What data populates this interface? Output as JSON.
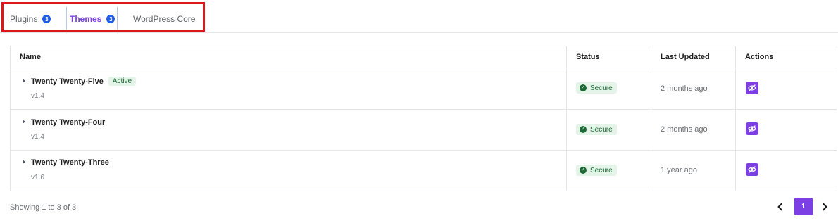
{
  "tabs": {
    "plugins": {
      "label": "Plugins",
      "count": "3"
    },
    "themes": {
      "label": "Themes",
      "count": "3"
    },
    "core": {
      "label": "WordPress Core"
    }
  },
  "table": {
    "headers": {
      "name": "Name",
      "status": "Status",
      "updated": "Last Updated",
      "actions": "Actions"
    },
    "rows": [
      {
        "name": "Twenty Twenty-Five",
        "badge": "Active",
        "version": "v1.4",
        "status": "Secure",
        "updated": "2 months ago",
        "action_icon": "eye-slash-icon"
      },
      {
        "name": "Twenty Twenty-Four",
        "version": "v1.4",
        "status": "Secure",
        "updated": "2 months ago",
        "action_icon": "eye-slash-icon"
      },
      {
        "name": "Twenty Twenty-Three",
        "version": "v1.6",
        "status": "Secure",
        "updated": "1 year ago",
        "action_icon": "eye-slash-icon"
      }
    ]
  },
  "footer": {
    "showing": "Showing 1 to 3 of 3"
  },
  "pagination": {
    "current": "1",
    "prev_icon": "chevron-left-icon",
    "next_icon": "chevron-right-icon"
  },
  "colors": {
    "accent": "#7b3fe4",
    "count_badge": "#1f5ee6",
    "highlight_box": "#e0161d",
    "secure_bg": "#e4f4e8",
    "secure_text": "#1e6b37"
  }
}
